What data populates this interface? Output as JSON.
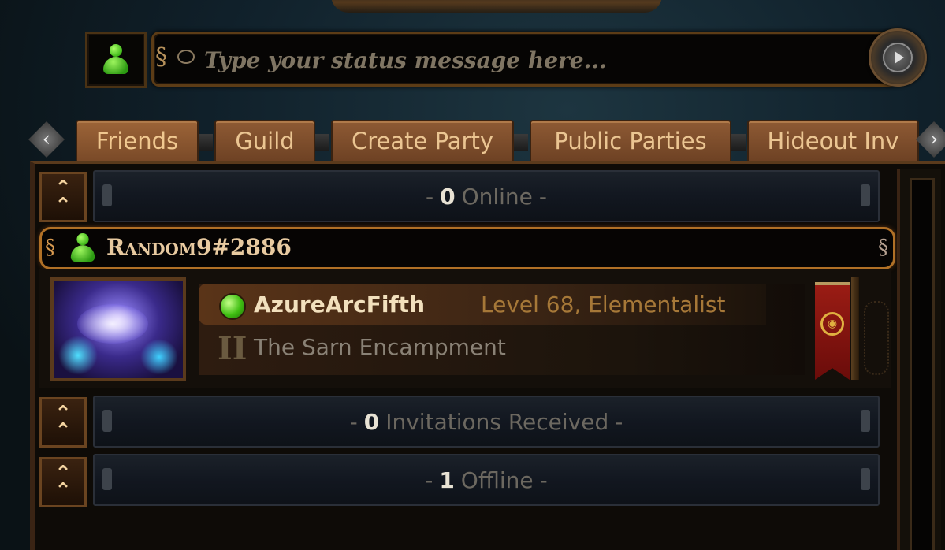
{
  "status": {
    "placeholder": "Type your status message here..."
  },
  "tabs": [
    {
      "label": "Friends",
      "active": true
    },
    {
      "label": "Guild",
      "active": false
    },
    {
      "label": "Create Party",
      "active": false
    },
    {
      "label": "Public Parties",
      "active": false
    },
    {
      "label": "Hideout Inv",
      "active": false
    }
  ],
  "sections": {
    "online": {
      "dash_l": "-",
      "count": "0",
      "label": "Online",
      "dash_r": "-"
    },
    "invitations": {
      "dash_l": "-",
      "count": "0",
      "label": "Invitations Received",
      "dash_r": "-"
    },
    "offline": {
      "dash_l": "-",
      "count": "1",
      "label": "Offline",
      "dash_r": "-"
    }
  },
  "account": {
    "name": "Random9#2886"
  },
  "character": {
    "name": "AzureArcFifth",
    "level_class": "Level 68, Elementalist",
    "location": "The Sarn Encampment",
    "act_numeral": "II"
  },
  "icons": {
    "status_icon": "person-icon",
    "send": "arrow-right-icon",
    "tab_prev": "chevron-left-icon",
    "tab_next": "chevron-right-icon",
    "collapse": "chevron-up-icon",
    "online_indicator": "online-dot-icon",
    "guild_banner": "banner-icon"
  },
  "colors": {
    "tab_text": "#ebc592",
    "account_border": "#b07026",
    "online_green": "#3fbf12",
    "level_text": "#a67838"
  }
}
